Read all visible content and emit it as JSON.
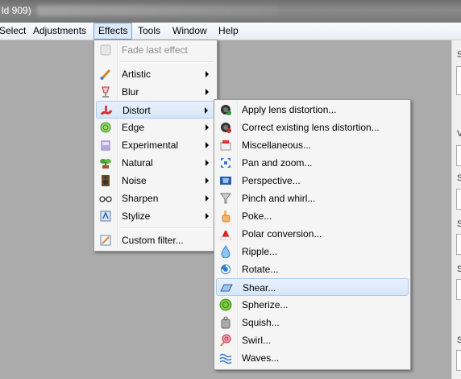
{
  "window": {
    "title_fragment": "ld 909)"
  },
  "menubar": {
    "items": [
      "Select",
      "Adjustments",
      "Effects",
      "Tools",
      "Window",
      "Help"
    ]
  },
  "effects_menu": {
    "fade_last_effect": "Fade last effect",
    "items": [
      "Artistic",
      "Blur",
      "Distort",
      "Edge",
      "Experimental",
      "Natural",
      "Noise",
      "Sharpen",
      "Stylize"
    ],
    "custom_filter": "Custom filter..."
  },
  "distort_menu": {
    "items": [
      "Apply lens distortion...",
      "Correct existing lens distortion...",
      "Miscellaneous...",
      "Pan and zoom...",
      "Perspective...",
      "Pinch and whirl...",
      "Poke...",
      "Polar conversion...",
      "Ripple...",
      "Rotate...",
      "Shear...",
      "Spherize...",
      "Squish...",
      "Swirl...",
      "Waves..."
    ],
    "highlighted": "Shear..."
  },
  "right_panel": {
    "labels": [
      "S",
      "V",
      "S",
      "S",
      "S",
      "S"
    ]
  },
  "colors": {
    "highlight": "#d6e6f8",
    "menu_bg": "#f5f5f5",
    "workspace": "#ababab"
  }
}
